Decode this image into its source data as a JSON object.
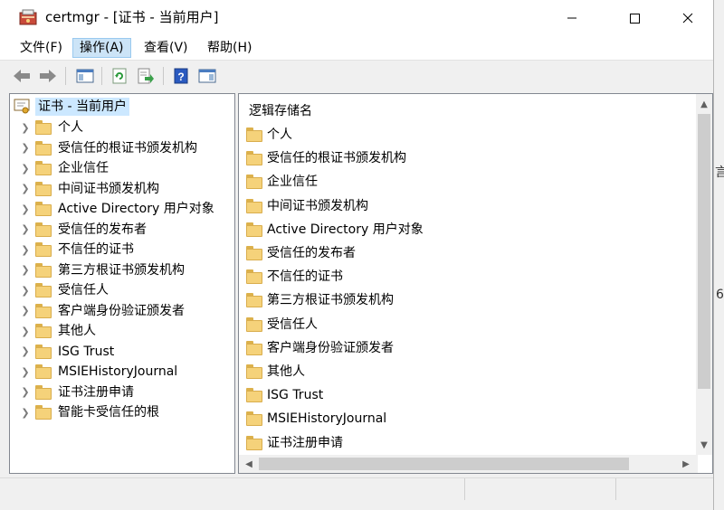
{
  "window": {
    "title": "certmgr - [证书 - 当前用户]",
    "controls": {
      "minimize": "minimize",
      "maximize": "maximize",
      "close": "close"
    }
  },
  "menu": [
    {
      "label": "文件(F)"
    },
    {
      "label": "操作(A)"
    },
    {
      "label": "查看(V)"
    },
    {
      "label": "帮助(H)"
    }
  ],
  "toolbar": {
    "icons": [
      "back-icon",
      "forward-icon",
      "show-hide-console-tree-icon",
      "refresh-icon",
      "export-list-icon",
      "help-icon",
      "show-action-pane-icon"
    ]
  },
  "tree": {
    "root_label": "证书 - 当前用户",
    "items": [
      {
        "label": "个人"
      },
      {
        "label": "受信任的根证书颁发机构"
      },
      {
        "label": "企业信任"
      },
      {
        "label": "中间证书颁发机构"
      },
      {
        "label": "Active Directory 用户对象"
      },
      {
        "label": "受信任的发布者"
      },
      {
        "label": "不信任的证书"
      },
      {
        "label": "第三方根证书颁发机构"
      },
      {
        "label": "受信任人"
      },
      {
        "label": "客户端身份验证颁发者"
      },
      {
        "label": "其他人"
      },
      {
        "label": "ISG Trust"
      },
      {
        "label": "MSIEHistoryJournal"
      },
      {
        "label": "证书注册申请"
      },
      {
        "label": "智能卡受信任的根"
      }
    ]
  },
  "list": {
    "column_header": "逻辑存储名",
    "items": [
      {
        "label": "个人"
      },
      {
        "label": "受信任的根证书颁发机构"
      },
      {
        "label": "企业信任"
      },
      {
        "label": "中间证书颁发机构"
      },
      {
        "label": "Active Directory 用户对象"
      },
      {
        "label": "受信任的发布者"
      },
      {
        "label": "不信任的证书"
      },
      {
        "label": "第三方根证书颁发机构"
      },
      {
        "label": "受信任人"
      },
      {
        "label": "客户端身份验证颁发者"
      },
      {
        "label": "其他人"
      },
      {
        "label": "ISG Trust"
      },
      {
        "label": "MSIEHistoryJournal"
      },
      {
        "label": "证书注册申请"
      }
    ]
  },
  "background_fragments": [
    "言",
    "6"
  ]
}
